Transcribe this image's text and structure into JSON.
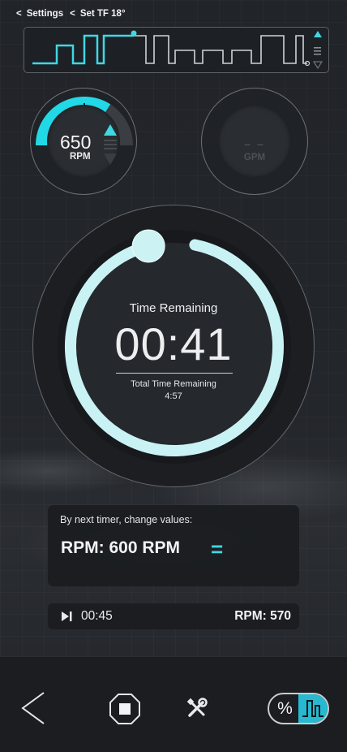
{
  "breadcrumb": {
    "back_chevron": "<",
    "settings_label": "Settings",
    "current_chevron": "<",
    "current_label": "Set TF 18°"
  },
  "program_strip": {
    "up_icon": "triangle-up-icon",
    "menu_icon": "menu-icon",
    "down_icon": "triangle-down-icon",
    "progress": 0.36
  },
  "rpm_gauge": {
    "value": "650",
    "unit": "RPM",
    "fill_fraction": 0.68
  },
  "gpm_gauge": {
    "value": "– –",
    "unit": "GPM"
  },
  "timer": {
    "label": "Time Remaining",
    "value": "00:41",
    "total_label": "Total Time Remaining",
    "total_value": "4:57",
    "progress_remaining": 0.96
  },
  "next_change": {
    "label": "By next timer, change values:",
    "value": "RPM: 600 RPM",
    "equals_symbol": "="
  },
  "next_step": {
    "icon": "skip-next-icon",
    "time": "00:45",
    "rpm": "RPM: 570"
  },
  "bottom_bar": {
    "back_icon": "back-chevron-icon",
    "stop_icon": "stop-octagon-icon",
    "tools_icon": "tools-icon",
    "toggle_percent": "%",
    "toggle_wave_icon": "waveform-icon"
  },
  "colors": {
    "accent": "#3fd7e4",
    "ring": "#c9f2f4",
    "background": "#212429"
  }
}
